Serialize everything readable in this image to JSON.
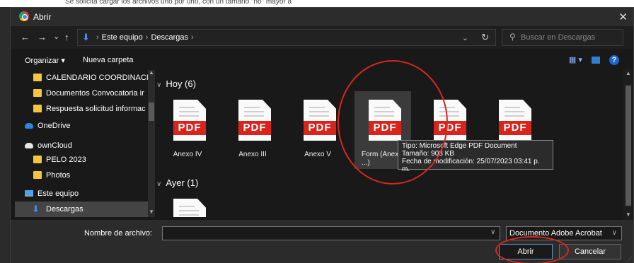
{
  "background": {
    "top_text": "Se solicita cargar los archivos uno por uno, con un tamaño \"no\" mayor a"
  },
  "colors": {
    "dialog_bg": "#191919",
    "accent": "#3c8ef5",
    "pdf_red": "#d9241b",
    "annotation_red": "#d8281e"
  },
  "titlebar": {
    "icon": "chrome-icon",
    "title": "Abrir",
    "close": "✕"
  },
  "nav": {
    "back": "←",
    "forward": "→",
    "recent": "⌄",
    "up": "↑"
  },
  "address": {
    "crumbs": [
      "Este equipo",
      "Descargas"
    ],
    "sep": "›"
  },
  "search": {
    "placeholder": "Buscar en Descargas"
  },
  "toolbar": {
    "organize": "Organizar ▾",
    "new_folder": "Nueva carpeta"
  },
  "sidebar": {
    "items": [
      {
        "label": "CALENDARIO COORDINACIÓ",
        "icon": "folder-icon"
      },
      {
        "label": "Documentos Convocatoria ir",
        "icon": "folder-icon"
      },
      {
        "label": "Respuesta solicitud informac",
        "icon": "folder-icon"
      },
      {
        "label": "OneDrive",
        "icon": "onedrive-cloud-icon"
      },
      {
        "label": "ownCloud",
        "icon": "owncloud-icon"
      },
      {
        "label": "PELO 2023",
        "icon": "folder-icon"
      },
      {
        "label": "Photos",
        "icon": "folder-icon"
      },
      {
        "label": "Este equipo",
        "icon": "computer-icon"
      },
      {
        "label": "Descargas",
        "icon": "download-icon",
        "selected": true
      }
    ]
  },
  "groups": [
    {
      "label": "Hoy (6)"
    },
    {
      "label": "Ayer (1)"
    }
  ],
  "files": [
    {
      "name": "Anexo IV"
    },
    {
      "name": "Anexo III"
    },
    {
      "name": "Anexo V"
    },
    {
      "name": "Form (Anexo ...)"
    },
    {
      "name": ""
    },
    {
      "name": ""
    },
    {
      "name": ""
    }
  ],
  "pdf_badge": "PDF",
  "tooltip": {
    "type": "Tipo: Microsoft Edge PDF Document",
    "size": "Tamaño: 908 KB",
    "modified": "Fecha de modificación: 25/07/2023 03:41 p. m."
  },
  "footer": {
    "filename_label": "Nombre de archivo:",
    "filename_value": "",
    "type_selected": "Documento Adobe Acrobat",
    "open": "Abrir",
    "cancel": "Cancelar"
  }
}
